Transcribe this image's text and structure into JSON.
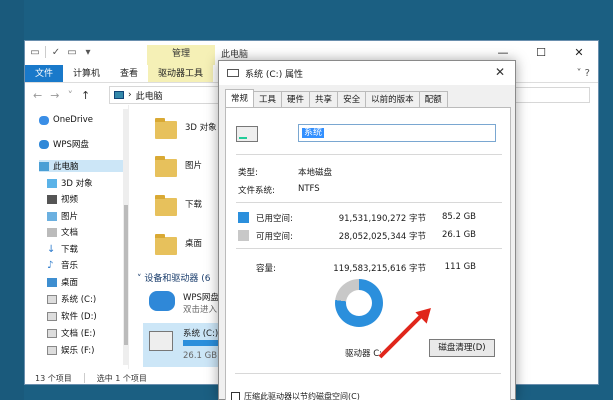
{
  "explorer": {
    "title": "此电脑",
    "context_tab": "管理",
    "ribbon_tabs": [
      "文件",
      "计算机",
      "查看",
      "驱动器工具"
    ],
    "window_controls": [
      "—",
      "☐",
      "✕"
    ],
    "breadcrumb": "此电脑",
    "nav_items": [
      {
        "label": "OneDrive"
      },
      {
        "label": "WPS网盘"
      },
      {
        "label": "此电脑"
      },
      {
        "label": "3D 对象"
      },
      {
        "label": "视频"
      },
      {
        "label": "图片"
      },
      {
        "label": "文档"
      },
      {
        "label": "下载"
      },
      {
        "label": "音乐"
      },
      {
        "label": "桌面"
      },
      {
        "label": "系统 (C:)"
      },
      {
        "label": "软件 (D:)"
      },
      {
        "label": "文档 (E:)"
      },
      {
        "label": "娱乐 (F:)"
      }
    ],
    "folders": [
      "3D 对象",
      "图片",
      "下载",
      "桌面"
    ],
    "group_label": "设备和驱动器 (6",
    "wps_drive": {
      "name": "WPS网盘",
      "sub": "双击进入"
    },
    "c_drive": {
      "name": "系统 (C:)",
      "sub": "26.1 GB"
    },
    "status": {
      "count": "13 个项目",
      "selected": "选中 1 个项目"
    }
  },
  "dialog": {
    "title": "系统 (C:) 属性",
    "tabs": [
      "常规",
      "工具",
      "硬件",
      "共享",
      "安全",
      "以前的版本",
      "配额"
    ],
    "active_tab": "常规",
    "name_value": "系统",
    "type_label": "类型:",
    "type_value": "本地磁盘",
    "fs_label": "文件系统:",
    "fs_value": "NTFS",
    "used_label": "已用空间:",
    "used_bytes": "91,531,190,272 字节",
    "used_gb": "85.2 GB",
    "free_label": "可用空间:",
    "free_bytes": "28,052,025,344 字节",
    "free_gb": "26.1 GB",
    "cap_label": "容量:",
    "cap_bytes": "119,583,215,616 字节",
    "cap_gb": "111 GB",
    "drive_label": "驱动器 C:",
    "cleanup_button": "磁盘清理(D)",
    "compress_label": "压缩此驱动器以节约磁盘空间(C)",
    "used_fraction": 0.77,
    "colors": {
      "used": "#2b8fdc",
      "free": "#c8c8c8"
    }
  }
}
